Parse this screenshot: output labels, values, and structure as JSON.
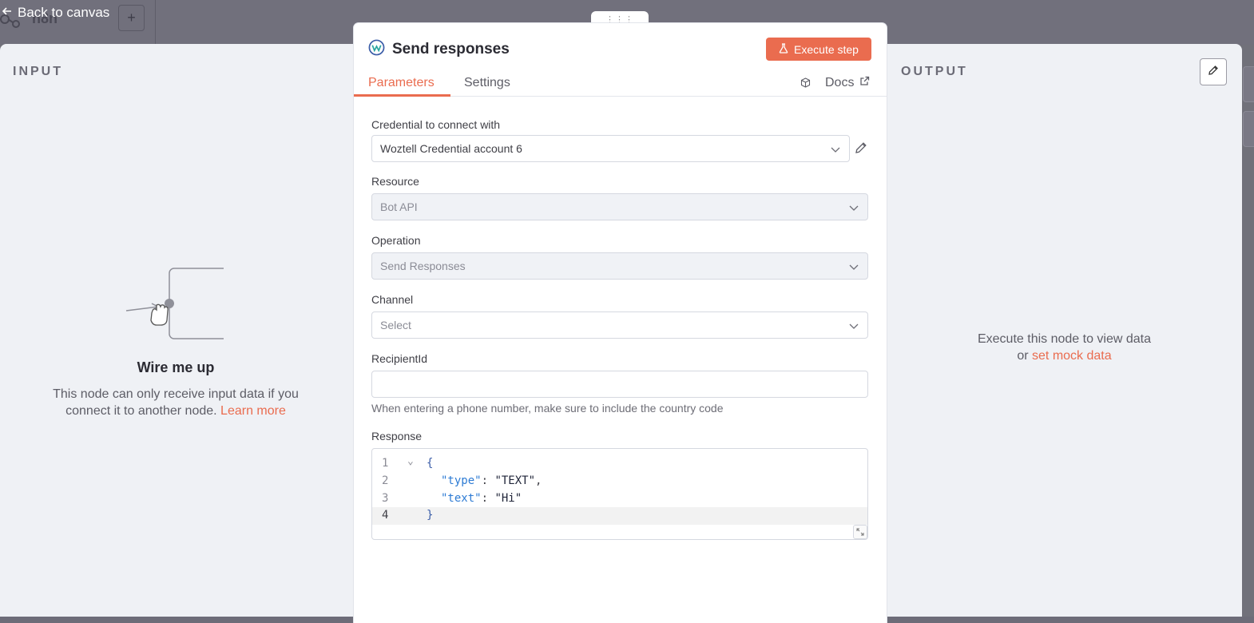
{
  "topbar": {
    "back_label": "Back to canvas",
    "workflow_name": "n8n",
    "add_label": "+"
  },
  "input_panel": {
    "title": "INPUT",
    "empty_title": "Wire me up",
    "empty_desc_line1": "This node can only receive input data if you",
    "empty_desc_line2": "connect it to another node.",
    "learn_more": "Learn more"
  },
  "output_panel": {
    "title": "OUTPUT",
    "empty_line1": "Execute this node to view data",
    "empty_or": "or",
    "mock_link": "set mock data"
  },
  "drag_handle": "⋮⋮⋮",
  "node": {
    "title": "Send responses",
    "execute_label": "Execute step",
    "tabs": {
      "parameters": "Parameters",
      "settings": "Settings"
    },
    "docs_label": "Docs"
  },
  "form": {
    "credential": {
      "label": "Credential to connect with",
      "value": "Woztell Credential account 6"
    },
    "resource": {
      "label": "Resource",
      "value": "Bot API"
    },
    "operation": {
      "label": "Operation",
      "value": "Send Responses"
    },
    "channel": {
      "label": "Channel",
      "placeholder": "Select"
    },
    "recipient": {
      "label": "RecipientId",
      "value": "",
      "hint": "When entering a phone number, make sure to include the country code"
    },
    "response": {
      "label": "Response",
      "lines": {
        "n1": "1",
        "n2": "2",
        "n3": "3",
        "n4": "4",
        "open": "{",
        "k1": "\"type\"",
        "colon": ": ",
        "v1": "\"TEXT\"",
        "comma": ",",
        "k2": "\"text\"",
        "v2": "\"Hi\"",
        "close": "}"
      }
    }
  },
  "colors": {
    "accent": "#ea6c4f",
    "backdrop": "#71717a",
    "panel_bg": "#eff1f5"
  }
}
